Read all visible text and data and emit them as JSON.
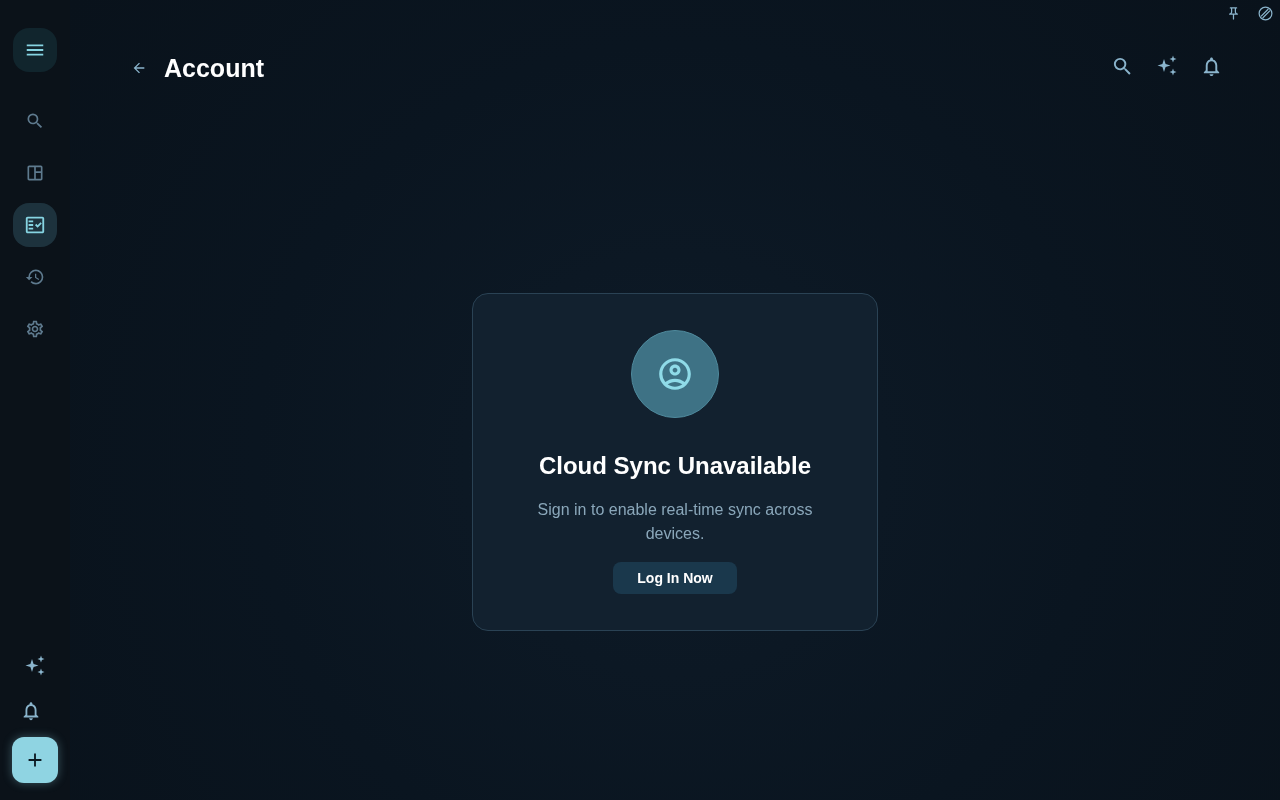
{
  "sidebar": {
    "nav_items": [
      {
        "selected": false
      },
      {
        "selected": false
      },
      {
        "selected": true
      },
      {
        "selected": false
      },
      {
        "selected": false
      }
    ]
  },
  "header": {
    "title": "Account"
  },
  "sync_card": {
    "title": "Cloud Sync Unavailable",
    "message": "Sign in to enable real-time sync across devices.",
    "button": "Log In Now"
  }
}
